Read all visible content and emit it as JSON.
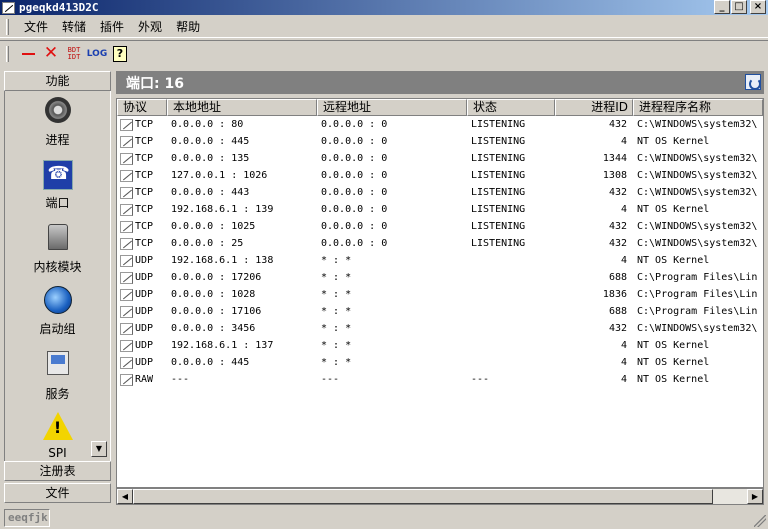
{
  "window": {
    "title": "pgeqkd413D2C",
    "min_glyph": "_",
    "max_glyph": "□",
    "close_glyph": "×"
  },
  "menu": [
    "文件",
    "转储",
    "插件",
    "外观",
    "帮助"
  ],
  "toolbar": {
    "icons": [
      "minus-icon",
      "delete-icon",
      "bdt-icon",
      "log-icon",
      "help-icon"
    ],
    "bdt_top": "BDT",
    "bdt_bottom": "IDT",
    "log_label": "LOG",
    "help_label": "?"
  },
  "sidebar": {
    "header": "功能",
    "items": [
      {
        "label": "进程",
        "icon": "gear-icon"
      },
      {
        "label": "端口",
        "icon": "port-icon"
      },
      {
        "label": "内核模块",
        "icon": "disk-icon"
      },
      {
        "label": "启动组",
        "icon": "globe-icon"
      },
      {
        "label": "服务",
        "icon": "computer-icon"
      },
      {
        "label": "SPI",
        "icon": "warning-icon"
      }
    ],
    "warn_mark": "!",
    "scroll_glyph": "▼",
    "footers": [
      "注册表",
      "文件"
    ]
  },
  "main": {
    "header": "端口: 16",
    "columns": [
      "协议",
      "本地地址",
      "远程地址",
      "状态",
      "进程ID",
      "进程程序名称"
    ],
    "rows": [
      [
        "TCP",
        "0.0.0.0 : 80",
        "0.0.0.0 : 0",
        "LISTENING",
        "432",
        "C:\\WINDOWS\\system32\\"
      ],
      [
        "TCP",
        "0.0.0.0 : 445",
        "0.0.0.0 : 0",
        "LISTENING",
        "4",
        "NT OS Kernel"
      ],
      [
        "TCP",
        "0.0.0.0 : 135",
        "0.0.0.0 : 0",
        "LISTENING",
        "1344",
        "C:\\WINDOWS\\system32\\"
      ],
      [
        "TCP",
        "127.0.0.1 : 1026",
        "0.0.0.0 : 0",
        "LISTENING",
        "1308",
        "C:\\WINDOWS\\system32\\"
      ],
      [
        "TCP",
        "0.0.0.0 : 443",
        "0.0.0.0 : 0",
        "LISTENING",
        "432",
        "C:\\WINDOWS\\system32\\"
      ],
      [
        "TCP",
        "192.168.6.1 : 139",
        "0.0.0.0 : 0",
        "LISTENING",
        "4",
        "NT OS Kernel"
      ],
      [
        "TCP",
        "0.0.0.0 : 1025",
        "0.0.0.0 : 0",
        "LISTENING",
        "432",
        "C:\\WINDOWS\\system32\\"
      ],
      [
        "TCP",
        "0.0.0.0 : 25",
        "0.0.0.0 : 0",
        "LISTENING",
        "432",
        "C:\\WINDOWS\\system32\\"
      ],
      [
        "UDP",
        "192.168.6.1 : 138",
        "* : *",
        "",
        "4",
        "NT OS Kernel"
      ],
      [
        "UDP",
        "0.0.0.0 : 17206",
        "* : *",
        "",
        "688",
        "C:\\Program Files\\Lin"
      ],
      [
        "UDP",
        "0.0.0.0 : 1028",
        "* : *",
        "",
        "1836",
        "C:\\Program Files\\Lin"
      ],
      [
        "UDP",
        "0.0.0.0 : 17106",
        "* : *",
        "",
        "688",
        "C:\\Program Files\\Lin"
      ],
      [
        "UDP",
        "0.0.0.0 : 3456",
        "* : *",
        "",
        "432",
        "C:\\WINDOWS\\system32\\"
      ],
      [
        "UDP",
        "192.168.6.1 : 137",
        "* : *",
        "",
        "4",
        "NT OS Kernel"
      ],
      [
        "UDP",
        "0.0.0.0 : 445",
        "* : *",
        "",
        "4",
        "NT OS Kernel"
      ],
      [
        "RAW",
        "---",
        "---",
        "---",
        "4",
        "NT OS Kernel"
      ]
    ]
  },
  "scroll": {
    "left_glyph": "◀",
    "right_glyph": "▶"
  },
  "status": {
    "text": "eeqfjk"
  }
}
